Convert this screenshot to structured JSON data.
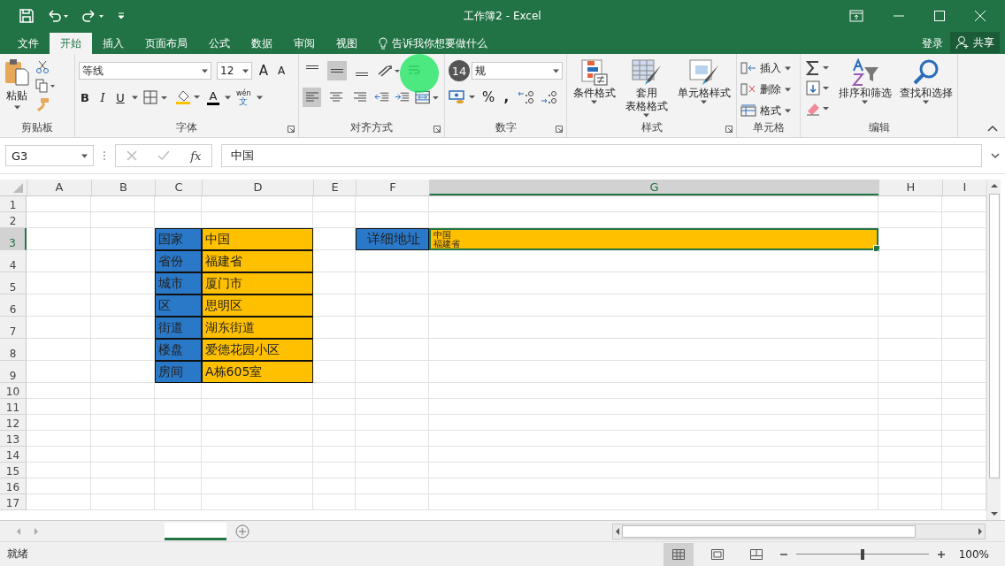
{
  "window": {
    "title": "工作簿2 - Excel"
  },
  "menu_tabs": [
    {
      "label": "文件",
      "selected": false
    },
    {
      "label": "开始",
      "selected": true
    },
    {
      "label": "插入",
      "selected": false
    },
    {
      "label": "页面布局",
      "selected": false
    },
    {
      "label": "公式",
      "selected": false
    },
    {
      "label": "数据",
      "selected": false
    },
    {
      "label": "审阅",
      "selected": false
    },
    {
      "label": "视图",
      "selected": false
    }
  ],
  "tell_me": "告诉我你想要做什么",
  "sign_in": "登录",
  "share": "共享",
  "ribbon": {
    "clipboard": {
      "label": "剪贴板",
      "paste": "粘贴"
    },
    "font": {
      "label": "字体",
      "font_name": "等线",
      "font_size": "12",
      "grow": "A",
      "shrink": "A",
      "bold": "B",
      "italic": "I",
      "underline": "U",
      "font_color": "A",
      "phonetic": "wén",
      "phonetic_char": "文"
    },
    "alignment": {
      "label": "对齐方式",
      "vertical": [
        {
          "selected": false
        },
        {
          "selected": true
        },
        {
          "selected": false
        }
      ],
      "horizontal": [
        {
          "selected": true
        },
        {
          "selected": false
        },
        {
          "selected": false
        }
      ]
    },
    "number": {
      "label": "数字",
      "format": "规",
      "percent": "%",
      "comma": ","
    },
    "styles": {
      "label": "样式",
      "buttons": [
        {
          "kind": "conditional",
          "lines": [
            "条件格式"
          ]
        },
        {
          "kind": "table",
          "lines": [
            "套用",
            "表格格式"
          ]
        },
        {
          "kind": "cellstyle",
          "lines": [
            "单元格样式"
          ]
        }
      ]
    },
    "cells": {
      "label": "单元格",
      "buttons": [
        {
          "kind": "insert",
          "label": "插入"
        },
        {
          "kind": "delete",
          "label": "删除"
        },
        {
          "kind": "format",
          "label": "格式"
        }
      ]
    },
    "editing": {
      "label": "编辑",
      "sort": "排序和筛选",
      "find": "查找和选择"
    }
  },
  "tutorial": {
    "step_badge": "14"
  },
  "formula_bar": {
    "name_box": "G3",
    "fx": "fx",
    "value": "中国"
  },
  "sheet": {
    "columns": [
      {
        "label": "A",
        "selected": false
      },
      {
        "label": "B",
        "selected": false
      },
      {
        "label": "C",
        "selected": false
      },
      {
        "label": "D",
        "selected": false
      },
      {
        "label": "E",
        "selected": false
      },
      {
        "label": "F",
        "selected": false
      },
      {
        "label": "G",
        "selected": true
      },
      {
        "label": "H",
        "selected": false
      },
      {
        "label": "I",
        "selected": false
      }
    ],
    "rows": [
      {
        "label": "1",
        "selected": false
      },
      {
        "label": "2",
        "selected": false
      },
      {
        "label": "3",
        "selected": true,
        "cells": {
          "C": {
            "kind": "label",
            "text": "国家"
          },
          "D": {
            "kind": "value",
            "text": "中国"
          },
          "F": {
            "kind": "header",
            "text": "详细地址"
          },
          "G": {
            "kind": "value",
            "lines": [
              "中国",
              "福建省"
            ],
            "selected": true
          }
        }
      },
      {
        "label": "4",
        "selected": false,
        "cells": {
          "C": {
            "kind": "label",
            "text": "省份"
          },
          "D": {
            "kind": "value",
            "text": "福建省"
          }
        }
      },
      {
        "label": "5",
        "selected": false,
        "cells": {
          "C": {
            "kind": "label",
            "text": "城市"
          },
          "D": {
            "kind": "value",
            "text": "厦门市"
          }
        }
      },
      {
        "label": "6",
        "selected": false,
        "cells": {
          "C": {
            "kind": "label",
            "text": "区"
          },
          "D": {
            "kind": "value",
            "text": "思明区"
          }
        }
      },
      {
        "label": "7",
        "selected": false,
        "cells": {
          "C": {
            "kind": "label",
            "text": "街道"
          },
          "D": {
            "kind": "value",
            "text": "湖东街道"
          }
        }
      },
      {
        "label": "8",
        "selected": false,
        "cells": {
          "C": {
            "kind": "label",
            "text": "楼盘"
          },
          "D": {
            "kind": "value",
            "text": "爱德花园小区"
          }
        }
      },
      {
        "label": "9",
        "selected": false,
        "cells": {
          "C": {
            "kind": "label",
            "text": "房间"
          },
          "D": {
            "kind": "value",
            "text": "A栋605室"
          }
        }
      },
      {
        "label": "10",
        "selected": false
      },
      {
        "label": "11",
        "selected": false
      },
      {
        "label": "12",
        "selected": false
      },
      {
        "label": "13",
        "selected": false
      },
      {
        "label": "14",
        "selected": false
      },
      {
        "label": "15",
        "selected": false
      },
      {
        "label": "16",
        "selected": false
      },
      {
        "label": "17",
        "selected": false
      }
    ]
  },
  "status_bar": {
    "status": "就绪",
    "views": [
      {
        "selected": true
      },
      {
        "selected": false
      },
      {
        "selected": false
      }
    ],
    "zoom": {
      "level": 0.5,
      "reading": "100%"
    }
  }
}
